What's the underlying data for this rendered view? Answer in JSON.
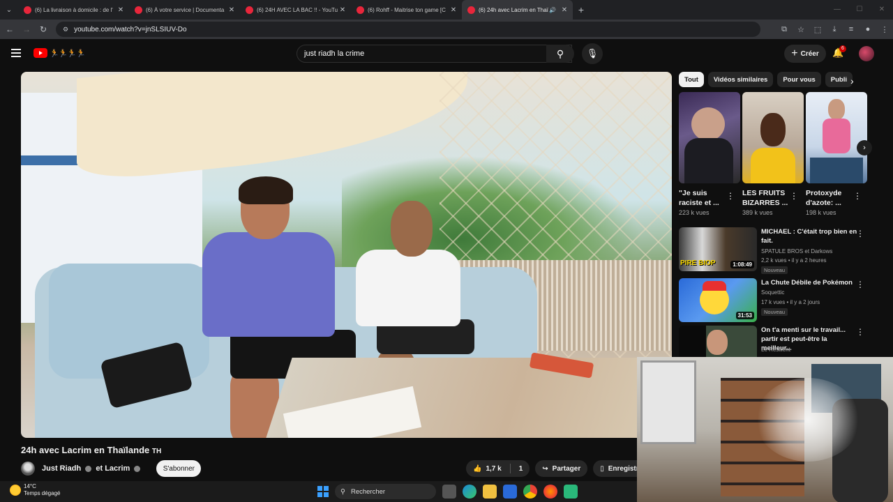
{
  "browser": {
    "tabs": [
      {
        "title": "(6) La livraison à domicile : de l'",
        "active": false
      },
      {
        "title": "(6) À votre service | Documenta",
        "active": false
      },
      {
        "title": "(6) 24H AVEC LA BAC !! - YouTu",
        "active": false
      },
      {
        "title": "(6) Rohff - Maitrise ton game [C",
        "active": false
      },
      {
        "title": "(6) 24h avec Lacrim en Thaï",
        "active": true
      }
    ],
    "url": "youtube.com/watch?v=jnSLSIUV-Do"
  },
  "youtube": {
    "search_query": "just riadh la crime",
    "create_label": "Créer",
    "notifications_count": "6",
    "video": {
      "title": "24h avec Lacrim en Thaïlande",
      "title_flag": "TH",
      "channel": "Just Riadh",
      "collab_conj": "et",
      "collab": "Lacrim",
      "subscribe": "S'abonner",
      "likes": "1,7 k",
      "comments": "1",
      "share": "Partager",
      "save": "Enregistr"
    },
    "chips": [
      "Tout",
      "Vidéos similaires",
      "Pour vous",
      "Publi"
    ],
    "shorts": [
      {
        "title": "\"Je suis raciste et ...",
        "views": "223 k vues"
      },
      {
        "title": "LES FRUITS BIZARRES ...",
        "views": "389 k vues"
      },
      {
        "title": "Protoxyde d'azote: ...",
        "views": "198 k vues"
      }
    ],
    "recommendations": [
      {
        "title": "MICHAEL : C'était trop bien en fait.",
        "channel": "SPATULE BROS et Darkows",
        "meta": "2,2 k vues • il y a 2 heures",
        "badge": "Nouveau",
        "duration": "1:08:49",
        "thumb_text": "PIRE BIOP"
      },
      {
        "title": "La Chute Débile de Pokémon",
        "channel": "Soquettic",
        "meta": "17 k vues • il y a 2 jours",
        "badge": "Nouveau",
        "duration": "31:53"
      },
      {
        "title": "On t'a menti sur le travail... partir est peut-être la meilleur...",
        "channel": "Le Résilient",
        "meta": "",
        "badge": "",
        "duration": ""
      }
    ]
  },
  "taskbar": {
    "temperature": "14°C",
    "weather": "Temps dégagé",
    "search": "Rechercher"
  },
  "colors": {
    "bg": "#0f0f0f",
    "accent_red": "#ff0000",
    "chip_active": "#f1f1f1"
  }
}
